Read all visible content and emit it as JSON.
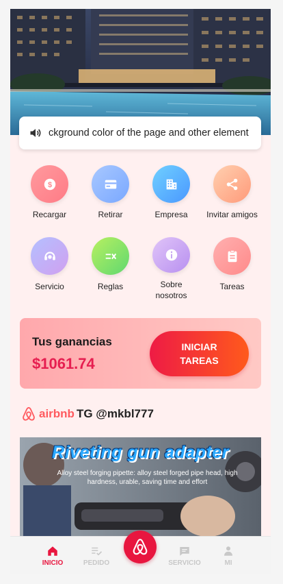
{
  "notice": {
    "text": "ckground color of the page and other element"
  },
  "actions": [
    {
      "label": "Recargar",
      "icon": "dollar-coin-icon",
      "color_from": "#ff9a9e",
      "color_to": "#ff7b86"
    },
    {
      "label": "Retirar",
      "icon": "credit-card-icon",
      "color_from": "#a8c8ff",
      "color_to": "#7aa8ff"
    },
    {
      "label": "Empresa",
      "icon": "building-icon",
      "color_from": "#70d0ff",
      "color_to": "#4a98ff"
    },
    {
      "label": "Invitar amigos",
      "icon": "share-icon",
      "color_from": "#ffd0b0",
      "color_to": "#ff9a7a"
    },
    {
      "label": "Servicio",
      "icon": "customer-service-icon",
      "color_from": "#b4c0ff",
      "color_to": "#d0a0f0"
    },
    {
      "label": "Reglas",
      "icon": "rules-icon",
      "color_from": "#b8f060",
      "color_to": "#60d870"
    },
    {
      "label": "Sobre nosotros",
      "icon": "info-icon",
      "color_from": "#e0c4f8",
      "color_to": "#b890f0"
    },
    {
      "label": "Tareas",
      "icon": "clipboard-icon",
      "color_from": "#ffb0b0",
      "color_to": "#ff8a8a"
    }
  ],
  "earnings": {
    "title": "Tus ganancias",
    "amount": "$1061.74",
    "button_label": "INICIAR TAREAS"
  },
  "brand": {
    "wordmark": "airbnb",
    "handle": "TG @mkbl777",
    "color": "#ff5a5f"
  },
  "banner": {
    "title": "Riveting gun adapter",
    "subtitle": "Alloy steel forging pipette: alloy steel forged pipe head, high hardness, urable, saving time and effort"
  },
  "tabs": [
    {
      "label": "INICIO",
      "icon": "home-icon",
      "active": true
    },
    {
      "label": "PEDIDO",
      "icon": "list-check-icon",
      "active": false
    },
    {
      "label": "SERVICIO",
      "icon": "chat-icon",
      "active": false
    },
    {
      "label": "MI",
      "icon": "person-icon",
      "active": false
    }
  ],
  "accent": "#e8163f"
}
